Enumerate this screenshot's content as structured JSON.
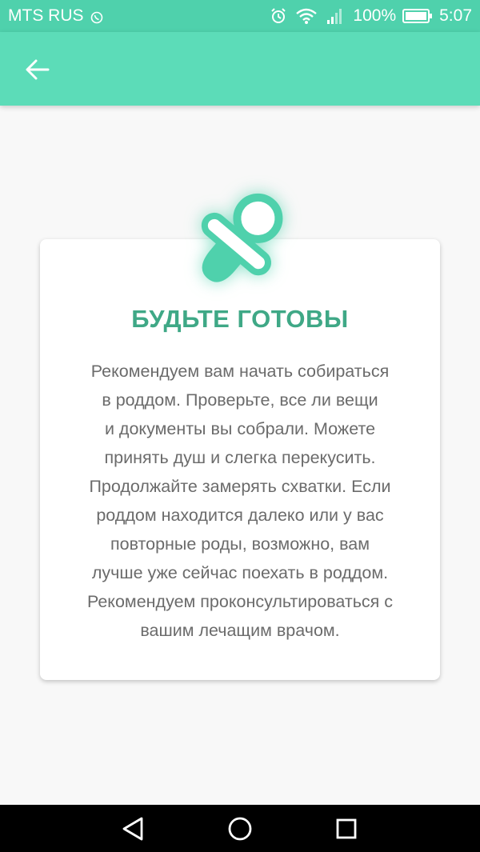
{
  "status_bar": {
    "carrier": "MTS RUS",
    "battery_percent": "100%",
    "time": "5:07",
    "icons": [
      "viber-icon",
      "alarm-icon",
      "wifi-icon",
      "signal-icon",
      "battery-icon"
    ]
  },
  "app_bar": {
    "back_icon": "arrow-left-icon"
  },
  "card": {
    "icon": "pacifier-icon",
    "title": "БУДЬТЕ ГОТОВЫ",
    "lines": [
      "Рекомендуем вам начать собираться",
      "в роддом. Проверьте, все ли вещи",
      "и документы вы собрали. Можете",
      "принять душ и слегка перекусить.",
      "Продолжайте замерять схватки. Если",
      "роддом находится далеко или у вас",
      "повторные роды, возможно, вам",
      "лучше уже сейчас поехать в роддом.",
      "Рекомендуем проконсультироваться с",
      "вашим лечащим врачом."
    ]
  },
  "nav_bar": {
    "icons": [
      "back-triangle-icon",
      "home-circle-icon",
      "recents-square-icon"
    ]
  },
  "colors": {
    "status_bar": "#4fd1ac",
    "app_bar": "#5cdcb8",
    "accent": "#3fa886",
    "background": "#f8f8f8",
    "card": "#ffffff",
    "body_text": "#6b6b6b"
  }
}
